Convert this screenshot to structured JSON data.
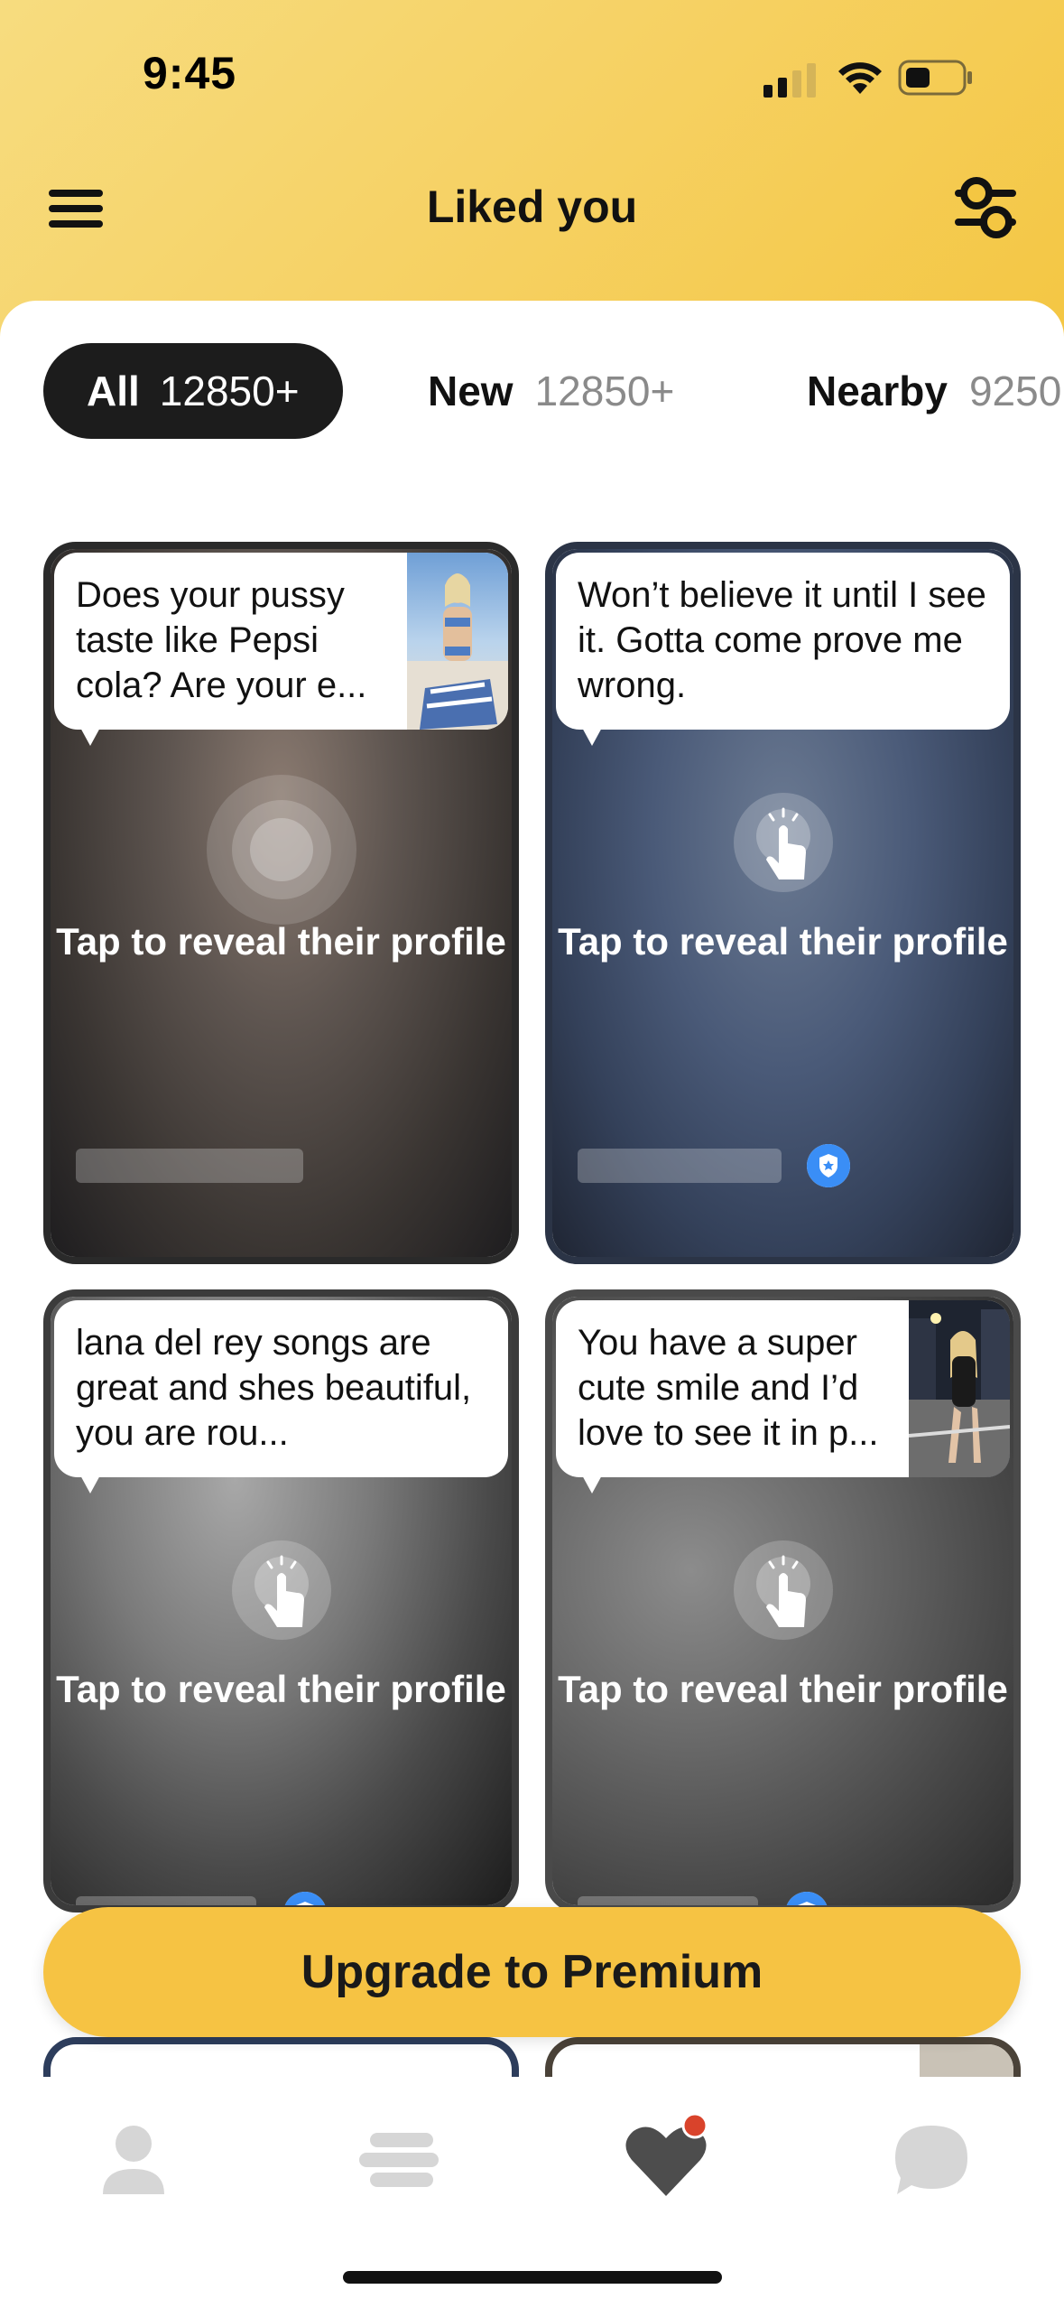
{
  "status_bar": {
    "time": "9:45"
  },
  "header": {
    "title": "Liked you"
  },
  "tabs": [
    {
      "label": "All",
      "count": "12850+",
      "active": true
    },
    {
      "label": "New",
      "count": "12850+",
      "active": false
    },
    {
      "label": "Nearby",
      "count": "9250",
      "active": false
    }
  ],
  "cards": [
    {
      "message": "Does your pussy taste like Pepsi cola? Are your e...",
      "reveal_text": "Tap to reveal their profile",
      "has_thumbnail": true,
      "verified": false
    },
    {
      "message": "Won’t believe it until I see it. Gotta come prove me wrong.",
      "reveal_text": "Tap to reveal their profile",
      "has_thumbnail": false,
      "verified": true
    },
    {
      "message": "lana del rey songs are great and shes beautiful, you are rou...",
      "reveal_text": "Tap to reveal their profile",
      "has_thumbnail": false,
      "verified": true
    },
    {
      "message": "You have a super cute smile and I’d love to see it in p...",
      "reveal_text": "Tap to reveal their profile",
      "has_thumbnail": true,
      "verified": true
    }
  ],
  "upgrade_button": {
    "label": "Upgrade to Premium"
  },
  "bottom_nav": [
    {
      "icon": "profile-icon"
    },
    {
      "icon": "discover-icon"
    },
    {
      "icon": "heart-icon",
      "has_notification": true
    },
    {
      "icon": "chat-icon"
    }
  ],
  "colors": {
    "accent": "#f6c343",
    "tab_active_bg": "#1c1c1c",
    "verified_blue": "#3a8ef6",
    "notification_red": "#d9432b"
  }
}
